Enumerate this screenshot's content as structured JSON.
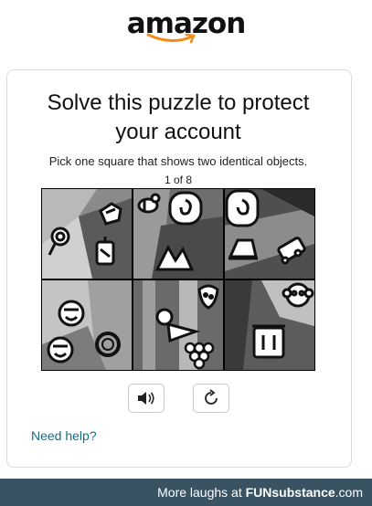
{
  "header": {
    "logo_text": "amazon"
  },
  "card": {
    "title_line1": "Solve this puzzle to protect",
    "title_line2": "your account",
    "instruction": "Pick one square that shows two identical objects.",
    "progress": "1 of 8"
  },
  "puzzle": {
    "tiles": [
      {
        "objects": [
          "hands-icon",
          "lollipop-icon",
          "lantern-icon"
        ]
      },
      {
        "objects": [
          "bee-icon",
          "swirl-icon",
          "mountains-icon"
        ]
      },
      {
        "objects": [
          "spiral-icon",
          "hat-icon",
          "train-icon"
        ]
      },
      {
        "objects": [
          "face-icon",
          "face-icon",
          "ring-icon"
        ]
      },
      {
        "objects": [
          "strawberry-icon",
          "cone-icon",
          "grapes-icon"
        ]
      },
      {
        "objects": [
          "monkey-icon",
          "trash-icon"
        ]
      }
    ]
  },
  "controls": {
    "audio_icon": "speaker-icon",
    "reload_icon": "reload-icon"
  },
  "help": {
    "label": "Need help?"
  },
  "footer": {
    "prefix": "More laughs at ",
    "brand": "FUNsubstance",
    "suffix": ".com"
  }
}
